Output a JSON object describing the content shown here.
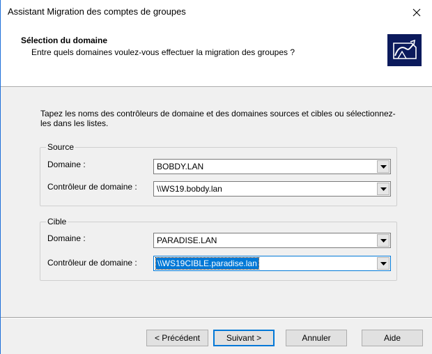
{
  "window": {
    "title": "Assistant Migration des comptes de groupes"
  },
  "header": {
    "title": "Sélection du domaine",
    "subtitle": "Entre quels domaines voulez-vous effectuer la migration des groupes ?"
  },
  "instructions": "Tapez les noms des contrôleurs de domaine et des domaines sources et cibles ou sélectionnez-les dans les listes.",
  "source": {
    "legend": "Source",
    "domain_label": "Domaine :",
    "domain_value": "BOBDY.LAN",
    "dc_label": "Contrôleur de domaine :",
    "dc_value": "\\\\WS19.bobdy.lan"
  },
  "target": {
    "legend": "Cible",
    "domain_label": "Domaine :",
    "domain_value": "PARADISE.LAN",
    "dc_label": "Contrôleur de domaine :",
    "dc_value": "\\\\WS19CIBLE.paradise.lan"
  },
  "buttons": {
    "previous": "< Précédent",
    "next": "Suivant >",
    "cancel": "Annuler",
    "help": "Aide"
  },
  "icons": {
    "close": "close-icon",
    "wizard": "migration-wizard-icon",
    "dropdown": "chevron-down-icon"
  },
  "colors": {
    "accent": "#0078d7",
    "window_border": "#1e6fd9",
    "wizard_icon_bg": "#0b1a5c"
  }
}
